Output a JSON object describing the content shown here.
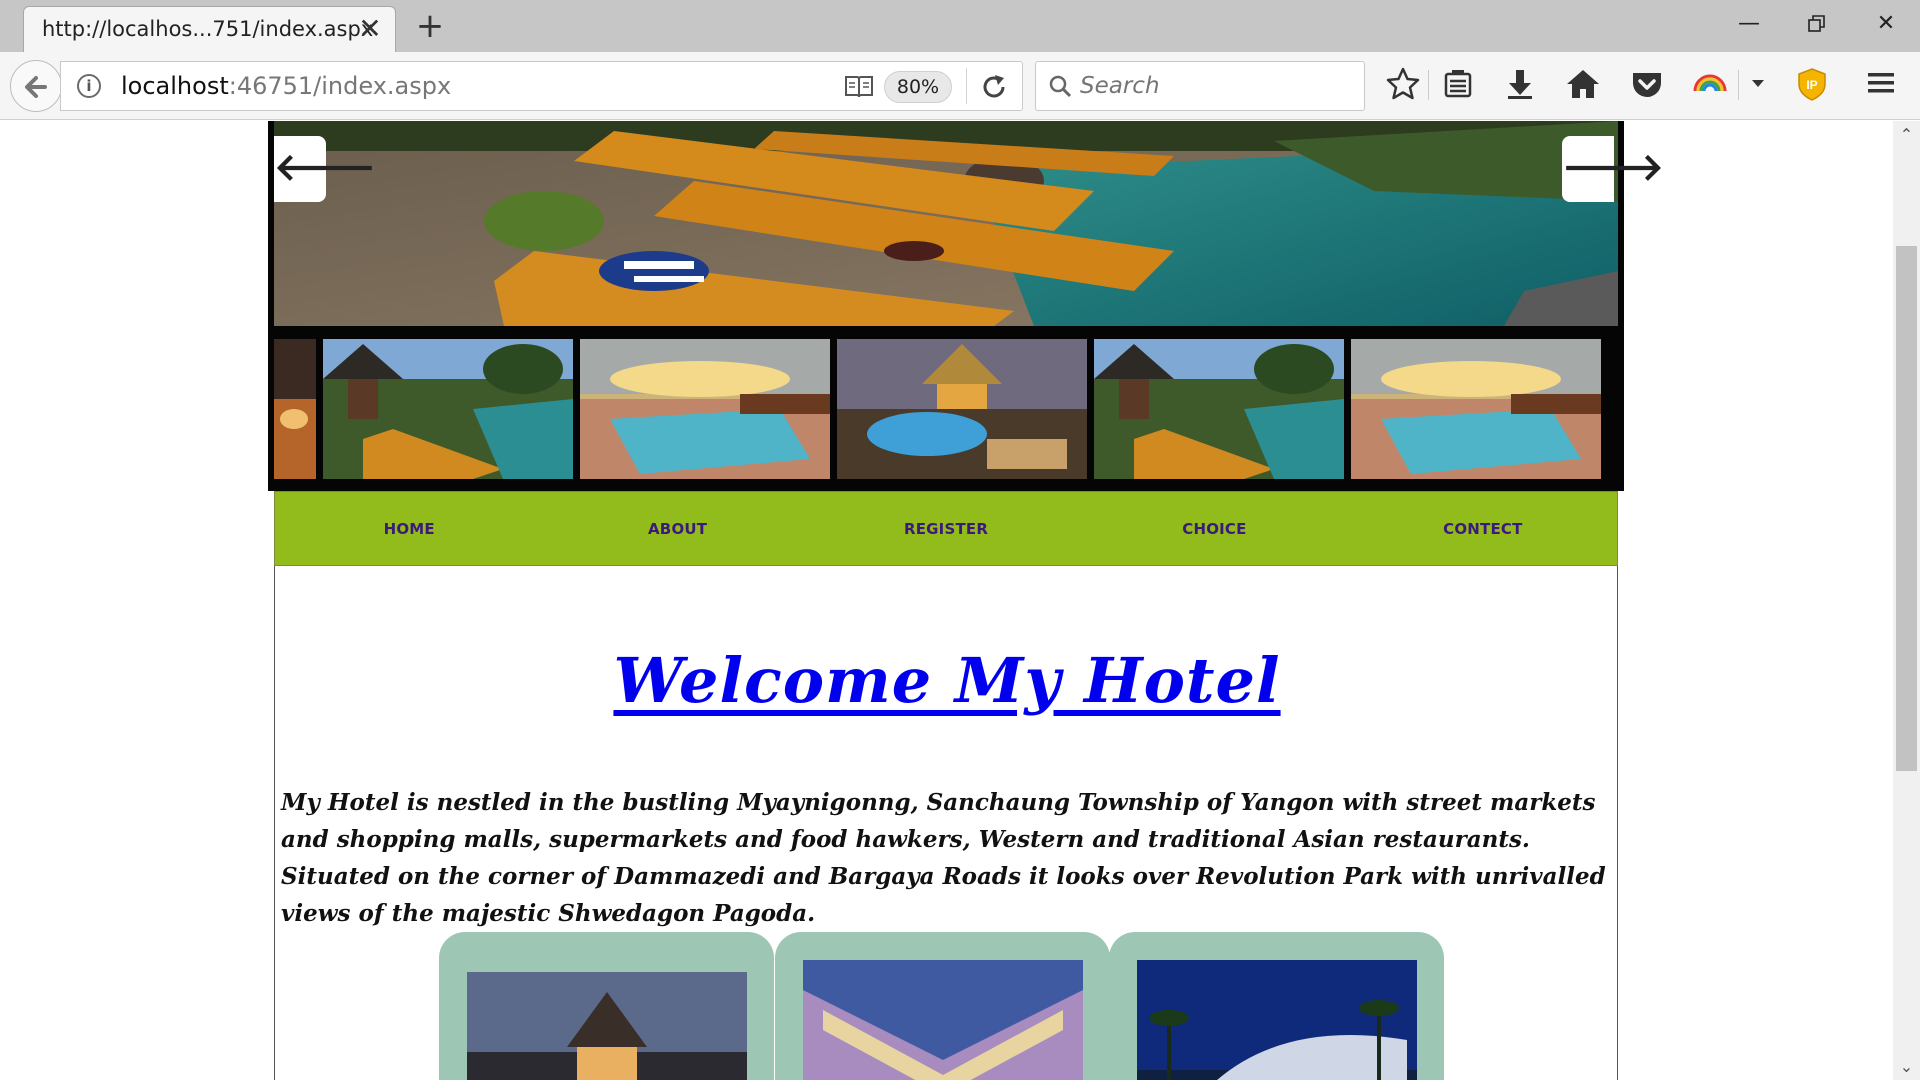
{
  "browser": {
    "tab_title": "http://localhos...751/index.aspx",
    "url_host": "localhost",
    "url_rest": ":46751/index.aspx",
    "zoom": "80%",
    "search_placeholder": "Search"
  },
  "site": {
    "menu": [
      {
        "label": "HOME"
      },
      {
        "label": "ABOUT"
      },
      {
        "label": "REGISTER"
      },
      {
        "label": "CHOICE"
      },
      {
        "label": "CONTECT"
      }
    ],
    "welcome": "Welcome My Hotel",
    "intro": "My Hotel is nestled in the bustling Myaynigonng, Sanchaung Township of Yangon with street markets and shopping malls, supermarkets and food hawkers, Western and traditional Asian restaurants. Situated on the corner of Dammazedi and Bargaya Roads it looks over Revolution Park with unrivalled views of the majestic Shwedagon Pagoda."
  },
  "colors": {
    "menu_bg": "#92bb1c",
    "menu_text": "#3b1a7a",
    "welcome": "#0000ee",
    "card_bg": "#9ec6b5"
  }
}
